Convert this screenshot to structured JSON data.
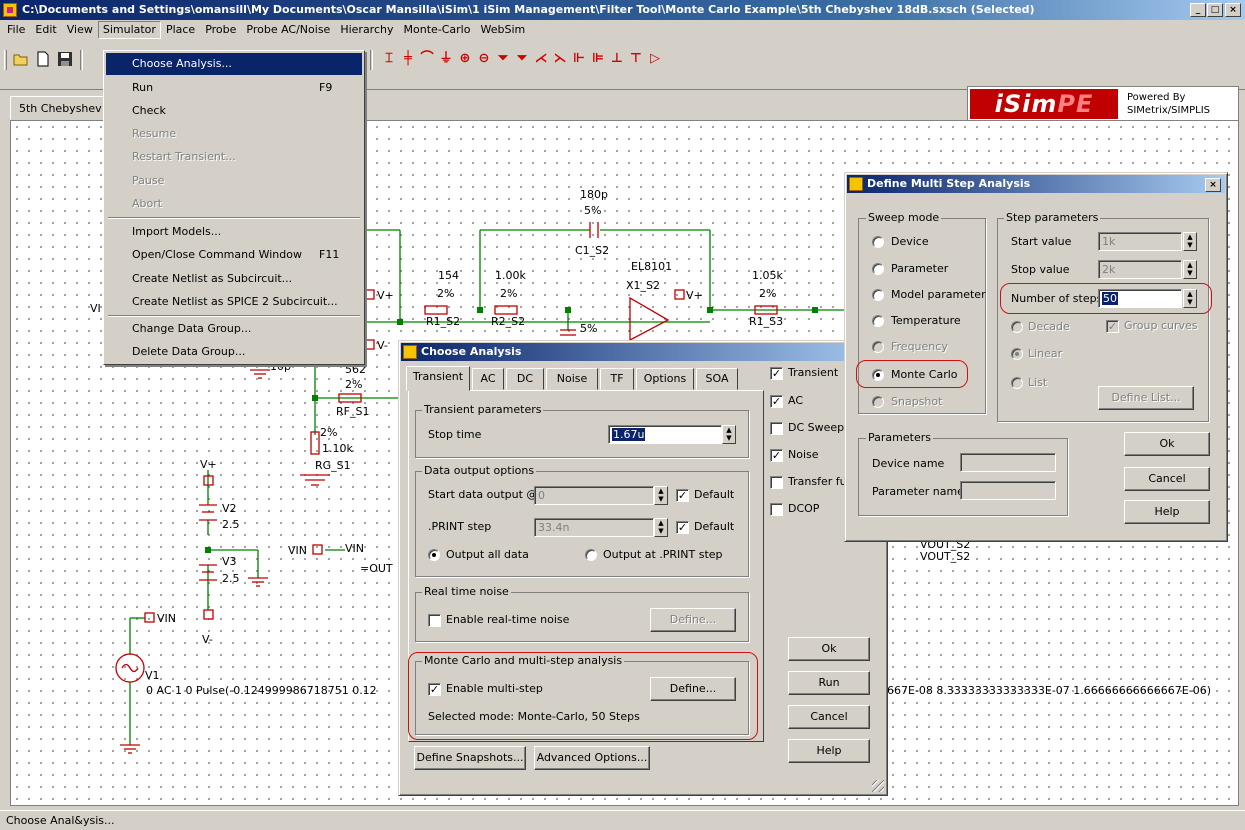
{
  "window": {
    "title": "C:\\Documents and Settings\\omansill\\My Documents\\Oscar Mansilla\\iSim\\1 iSim Management\\Filter Tool\\Monte Carlo Example\\5th Chebyshev 18dB.sxsch (Selected)",
    "buttons": [
      "_",
      "□",
      "×"
    ]
  },
  "menubar": [
    "File",
    "Edit",
    "View",
    "Simulator",
    "Place",
    "Probe",
    "Probe AC/Noise",
    "Hierarchy",
    "Monte-Carlo",
    "WebSim"
  ],
  "simulator_menu": [
    {
      "label": "Choose Analysis...",
      "key": "",
      "state": "selected"
    },
    {
      "label": "Run",
      "key": "F9",
      "state": "normal"
    },
    {
      "label": "Check",
      "key": "",
      "state": "normal"
    },
    {
      "label": "Resume",
      "key": "",
      "state": "disabled"
    },
    {
      "label": "Restart Transient...",
      "key": "",
      "state": "disabled"
    },
    {
      "label": "Pause",
      "key": "",
      "state": "disabled"
    },
    {
      "label": "Abort",
      "key": "",
      "state": "disabled"
    },
    {
      "label": "Import Models...",
      "key": "",
      "state": "normal"
    },
    {
      "label": "Open/Close Command Window",
      "key": "F11",
      "state": "normal"
    },
    {
      "label": "Create Netlist as Subcircuit...",
      "key": "",
      "state": "normal"
    },
    {
      "label": "Create Netlist as SPICE 2 Subcircuit...",
      "key": "",
      "state": "normal"
    },
    {
      "label": "Change Data Group...",
      "key": "",
      "state": "normal"
    },
    {
      "label": "Delete Data Group...",
      "key": "",
      "state": "normal"
    }
  ],
  "logo": {
    "brand_a": "iSim",
    "brand_b": "PE",
    "powered": "Powered By",
    "by": "SIMetrix/SIMPLIS"
  },
  "doc_tab": "5th Chebyshev",
  "status_text": "Choose Anal&ysis...",
  "schematic": {
    "c1_val": "180p",
    "c1_tol": "5%",
    "c1_name": "C1_S2",
    "amp_part": "EL8101",
    "amp_name": "X1_S2",
    "r1_val": "154",
    "r1_tol": "2%",
    "r1_name": "R1_S2",
    "r2_val": "1.00k",
    "r2_tol": "2%",
    "r2_name": "R2_S2",
    "r3_val": "1.05k",
    "r3_tol": "2%",
    "r3_name": "R1_S3",
    "c2_tol": "5%",
    "vplus": "V+",
    "vplus2": "V+",
    "vplus3": "V+",
    "vminus": "V-",
    "vminus2": "V-",
    "rf_val": "562",
    "rf_tol": "2%",
    "rf_name": "RF_S1",
    "c_10p": "10p",
    "rg_tol": "2%",
    "rg_val": "1.10k",
    "rg_name": "RG_S1",
    "v2_name": "V2",
    "v2_val": "2.5",
    "v3_name": "V3",
    "v3_val": "2.5",
    "vin_label": "VIN",
    "vin_box": "VIN",
    "vin_out": "=OUT",
    "vin_src": "VIN",
    "v1_name": "V1",
    "v1_spec_left": "0 AC 1 0 Pulse(-0.124999986718751 0.12",
    "v1_spec_right": "667E-08 8.33333333333333E-07 1.66666666666667E-06)",
    "vout_a": "VOUT_S2",
    "vout_b": "VOUT_S2",
    "vi_frag": "VI"
  },
  "choose_analysis": {
    "title": "Choose Analysis",
    "tabs": [
      "Transient",
      "AC",
      "DC",
      "Noise",
      "TF",
      "Options",
      "SOA"
    ],
    "transient_params": {
      "label": "Transient parameters",
      "stop_time_label": "Stop time",
      "stop_time_value": "1.67u"
    },
    "data_output": {
      "label": "Data output options",
      "start_label": "Start data output @",
      "start_value": "0",
      "start_default": "Default",
      "print_label": ".PRINT step",
      "print_value": "33.4n",
      "print_default": "Default",
      "radio_all": "Output all data",
      "radio_print": "Output at .PRINT step"
    },
    "realtime_noise": {
      "label": "Real time noise",
      "enable_label": "Enable real-time noise",
      "define": "Define..."
    },
    "monte_carlo": {
      "label": "Monte Carlo and multi-step analysis",
      "enable_label": "Enable multi-step",
      "define": "Define...",
      "mode_text": "Selected mode: Monte-Carlo, 50 Steps"
    },
    "bottom_buttons": [
      "Define Snapshots...",
      "Advanced Options..."
    ],
    "analyses": [
      {
        "label": "Transient",
        "checked": true
      },
      {
        "label": "AC",
        "checked": true
      },
      {
        "label": "DC Sweep",
        "checked": false
      },
      {
        "label": "Noise",
        "checked": true
      },
      {
        "label": "Transfer fu",
        "checked": false
      },
      {
        "label": "DCOP",
        "checked": false
      }
    ],
    "side_buttons": [
      "Ok",
      "Run",
      "Cancel",
      "Help"
    ]
  },
  "multi_step": {
    "title": "Define Multi Step Analysis",
    "sweep_mode_label": "Sweep mode",
    "sweep_modes": [
      {
        "label": "Device",
        "checked": false,
        "enabled": true
      },
      {
        "label": "Parameter",
        "checked": false,
        "enabled": true
      },
      {
        "label": "Model parameter",
        "checked": false,
        "enabled": true
      },
      {
        "label": "Temperature",
        "checked": false,
        "enabled": true
      },
      {
        "label": "Frequency",
        "checked": false,
        "enabled": false
      },
      {
        "label": "Monte Carlo",
        "checked": true,
        "enabled": true
      },
      {
        "label": "Snapshot",
        "checked": false,
        "enabled": false
      }
    ],
    "step_params": {
      "label": "Step parameters",
      "start_label": "Start value",
      "start_value": "1k",
      "stop_label": "Stop value",
      "stop_value": "2k",
      "steps_label": "Number of steps",
      "steps_value": "50",
      "decade": "Decade",
      "linear": "Linear",
      "list": "List",
      "group_curves": "Group curves",
      "define_list": "Define List..."
    },
    "parameters": {
      "label": "Parameters",
      "device_label": "Device name",
      "param_label": "Parameter name"
    },
    "buttons": [
      "Ok",
      "Cancel",
      "Help"
    ]
  },
  "colors": {
    "accent": "#0a246a",
    "highlight": "#d01010",
    "wire": "#008000",
    "component": "#c00000"
  }
}
